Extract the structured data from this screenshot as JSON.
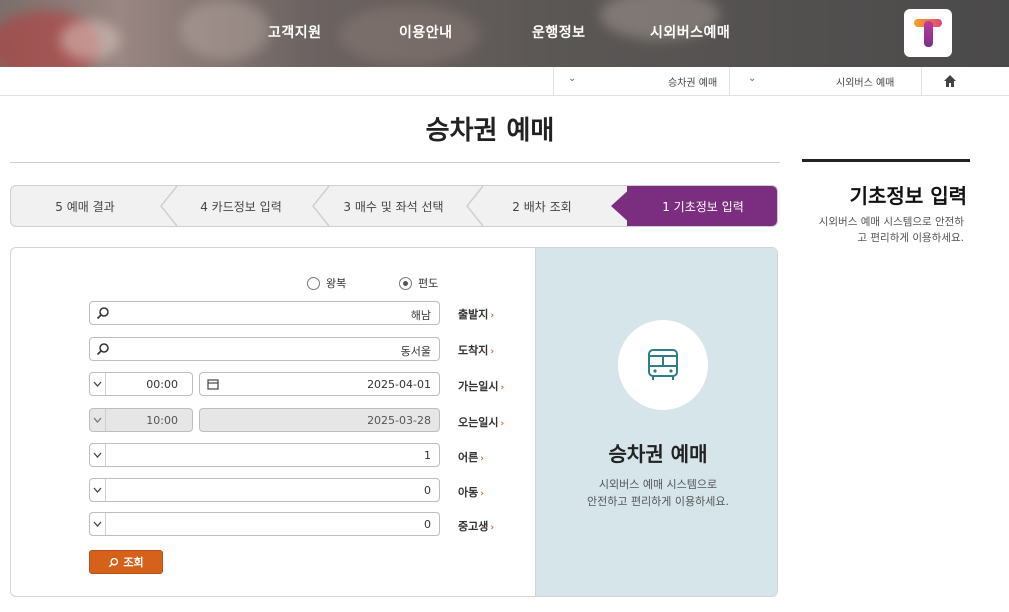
{
  "nav": {
    "items": [
      "시외버스예매",
      "운행정보",
      "이용안내",
      "고객지원"
    ]
  },
  "breadcrumb": {
    "level1": "시외버스 예매",
    "level2": "승차권 예매"
  },
  "page": {
    "title": "승차권 예매"
  },
  "sidebar": {
    "title": "기초정보 입력",
    "desc_line1": "시외버스 예매 시스템으로 안전하",
    "desc_line2": "고 편리하게 이용하세요."
  },
  "steps": [
    "1 기초정보 입력",
    "2 배차 조회",
    "3 매수 및 좌석 선택",
    "4 카드정보 입력",
    "5 예매 결과"
  ],
  "trip_type": {
    "oneway": "편도",
    "roundtrip": "왕복",
    "selected": "편도"
  },
  "form": {
    "departure_label": "출발지",
    "departure_value": "해남",
    "arrival_label": "도착지",
    "arrival_value": "동서울",
    "depart_date_label": "가는일시",
    "depart_date_value": "2025-04-01",
    "depart_time_value": "00:00",
    "return_date_label": "오는일시",
    "return_date_value": "2025-03-28",
    "return_time_value": "10:00",
    "adult_label": "어른",
    "adult_value": "1",
    "child_label": "아동",
    "child_value": "0",
    "teen_label": "중고생",
    "teen_value": "0",
    "search_button": "조회"
  },
  "info_panel": {
    "title": "승차권 예매",
    "desc_line1": "시외버스 예매 시스템으로",
    "desc_line2": "안전하고 편리하게 이용하세요."
  },
  "colors": {
    "step_active": "#7b2e7f",
    "search_button": "#d5611a",
    "panel_bg": "#d5e5ea",
    "required_mark": "#e05a1e"
  }
}
